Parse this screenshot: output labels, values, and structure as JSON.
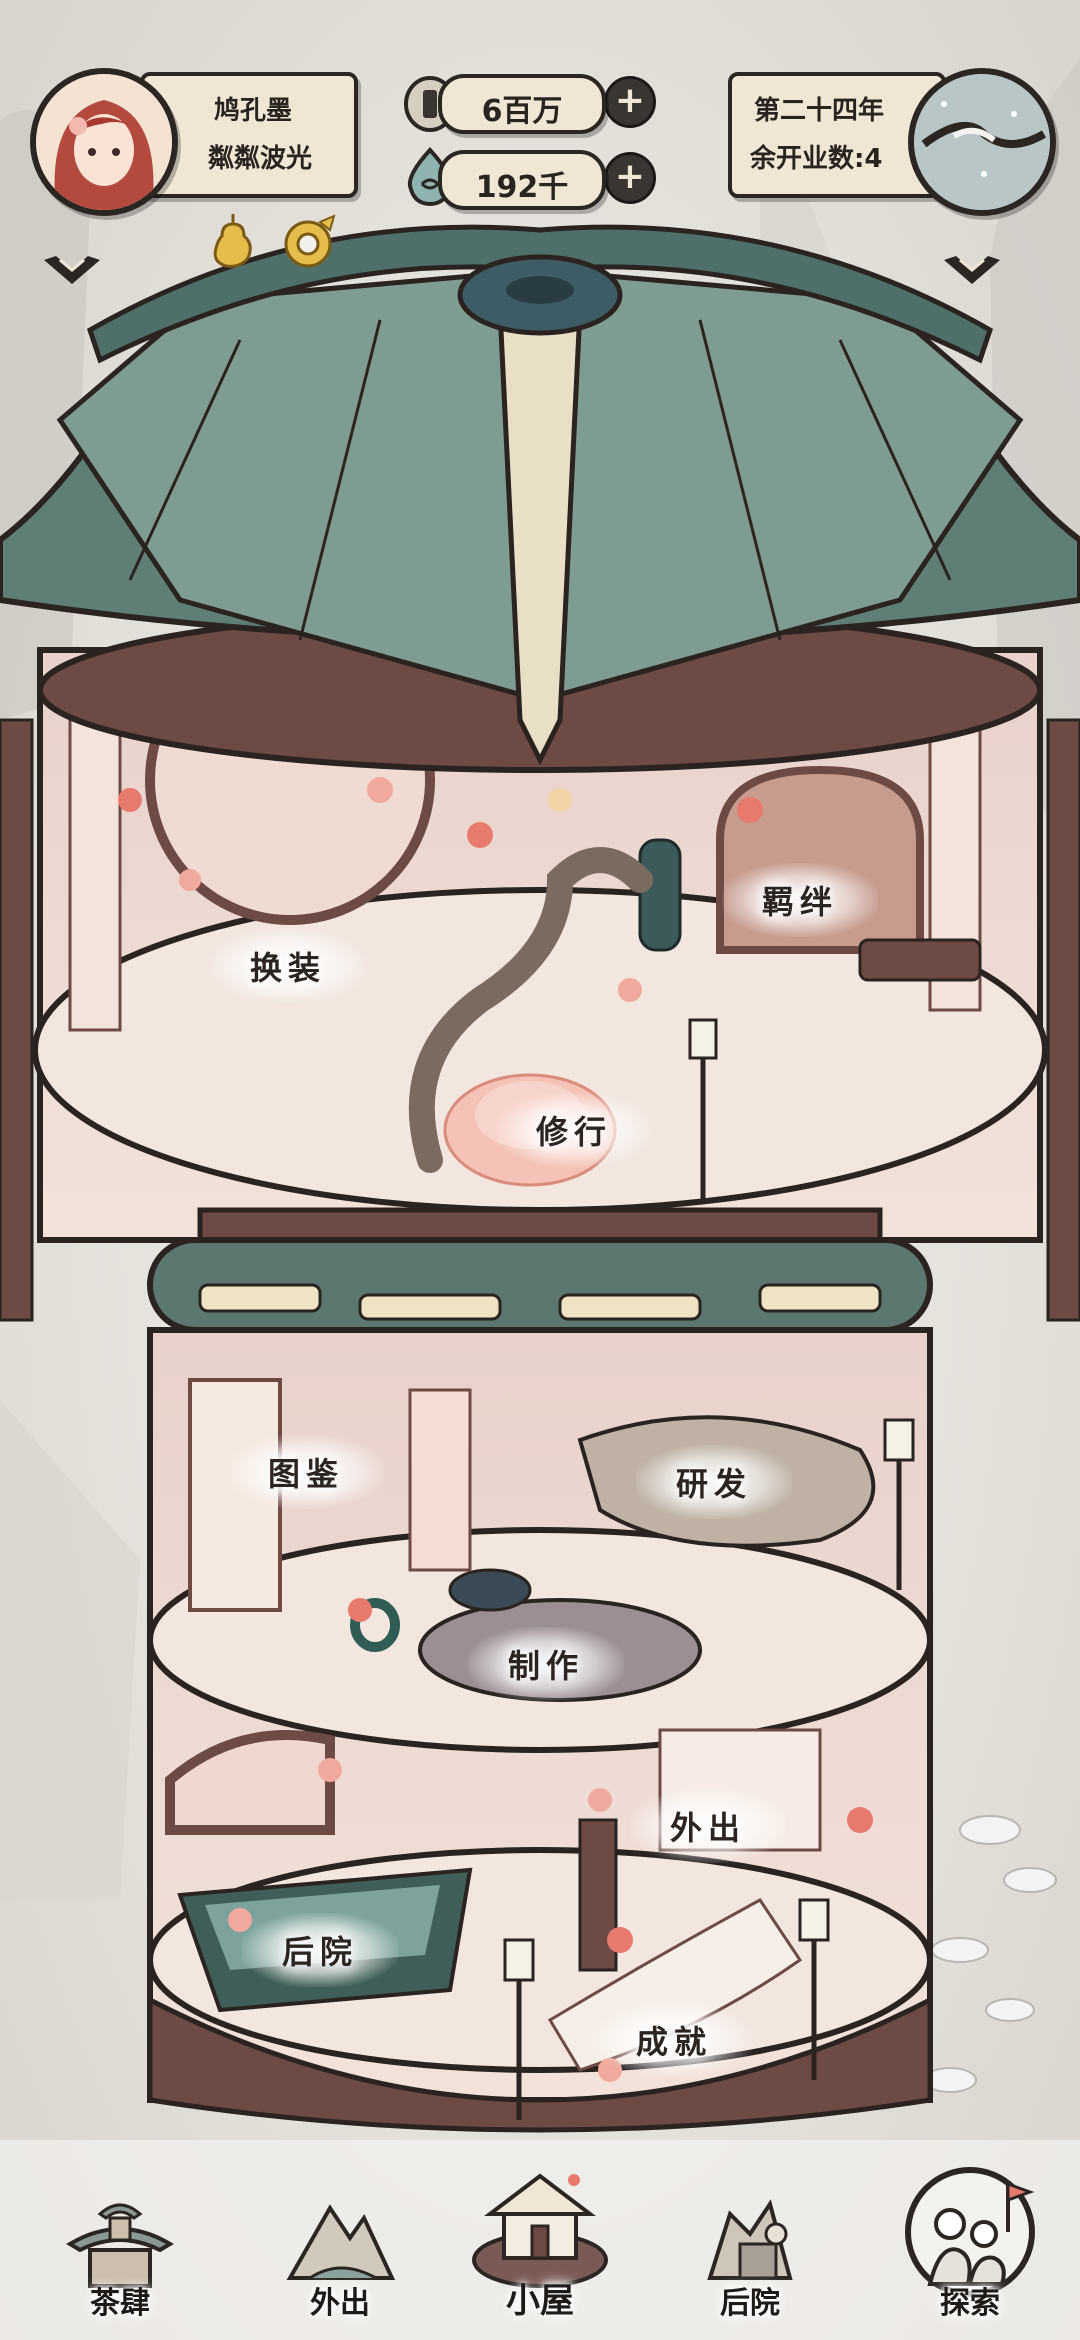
{
  "player": {
    "name": "鸠孔墨",
    "title": "粼粼波光"
  },
  "currency": {
    "coins": "6百万",
    "jade": "192千"
  },
  "calendar": {
    "year": "第二十四年",
    "remaining": "余开业数:4"
  },
  "rooms": {
    "dress": "换装",
    "bond": "羁绊",
    "practice": "修行",
    "codex": "图鉴",
    "research": "研发",
    "craft": "制作",
    "outing": "外出",
    "backyard": "后院",
    "achievement": "成就"
  },
  "nav": {
    "teahouse": "茶肆",
    "outing": "外出",
    "cabin": "小屋",
    "backyard": "后院",
    "explore": "探索"
  },
  "colors": {
    "roof": "#5f7f74",
    "wood": "#6e4a45",
    "parchment": "#efe7d4",
    "floor": "#f0e4dc"
  }
}
